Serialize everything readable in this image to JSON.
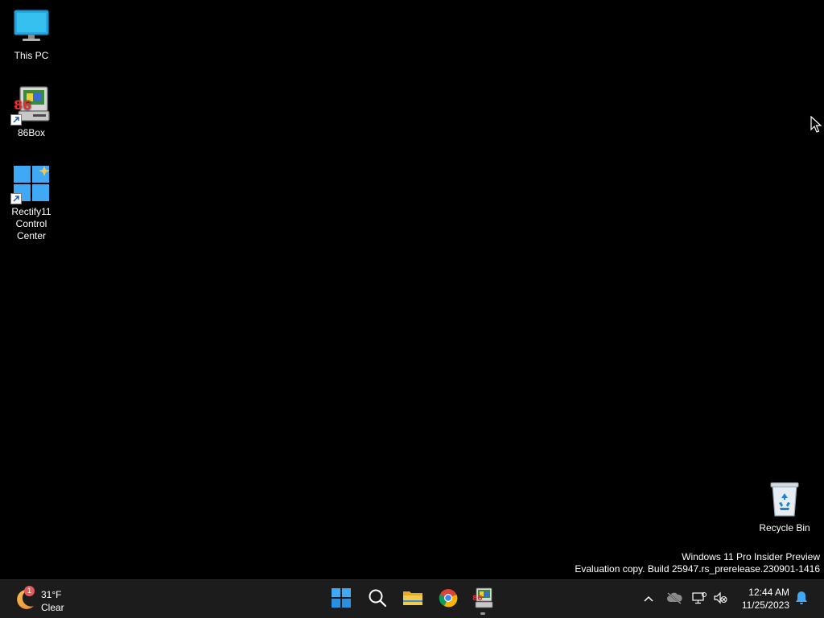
{
  "desktop": {
    "icons": [
      {
        "label": "This PC",
        "icon": "monitor-icon"
      },
      {
        "label": "86Box",
        "icon": "86box-icon"
      },
      {
        "label": "Rectify11 Control Center",
        "label_lines": [
          "Rectify11",
          "Control",
          "Center"
        ],
        "icon": "rectify11-icon"
      },
      {
        "label": "Recycle Bin",
        "icon": "recycle-bin-icon"
      }
    ],
    "watermark": {
      "line1": "Windows 11 Pro Insider Preview",
      "line2": "Evaluation copy. Build 25947.rs_prerelease.230901-1416"
    }
  },
  "taskbar": {
    "weather": {
      "temperature": "31°F",
      "condition": "Clear",
      "badge": "1",
      "icon": "moon-icon"
    },
    "pinned": [
      {
        "name": "start-button",
        "icon": "windows-logo-icon"
      },
      {
        "name": "search-button",
        "icon": "search-icon"
      },
      {
        "name": "file-explorer-button",
        "icon": "folder-icon"
      },
      {
        "name": "chrome-button",
        "icon": "chrome-icon"
      },
      {
        "name": "86box-taskbar-button",
        "icon": "86box-icon",
        "running": true
      }
    ],
    "tray": {
      "icons": [
        "chevron-up-icon",
        "cloud-off-icon",
        "network-icon",
        "volume-muted-icon",
        "notification-bell-icon"
      ],
      "time": "12:44 AM",
      "date": "11/25/2023"
    }
  },
  "colors": {
    "desktop_background": "#000000",
    "taskbar_background": "#1c1c1c",
    "accent_blue": "#0078d4",
    "notification_blue": "#3fa9f5"
  }
}
